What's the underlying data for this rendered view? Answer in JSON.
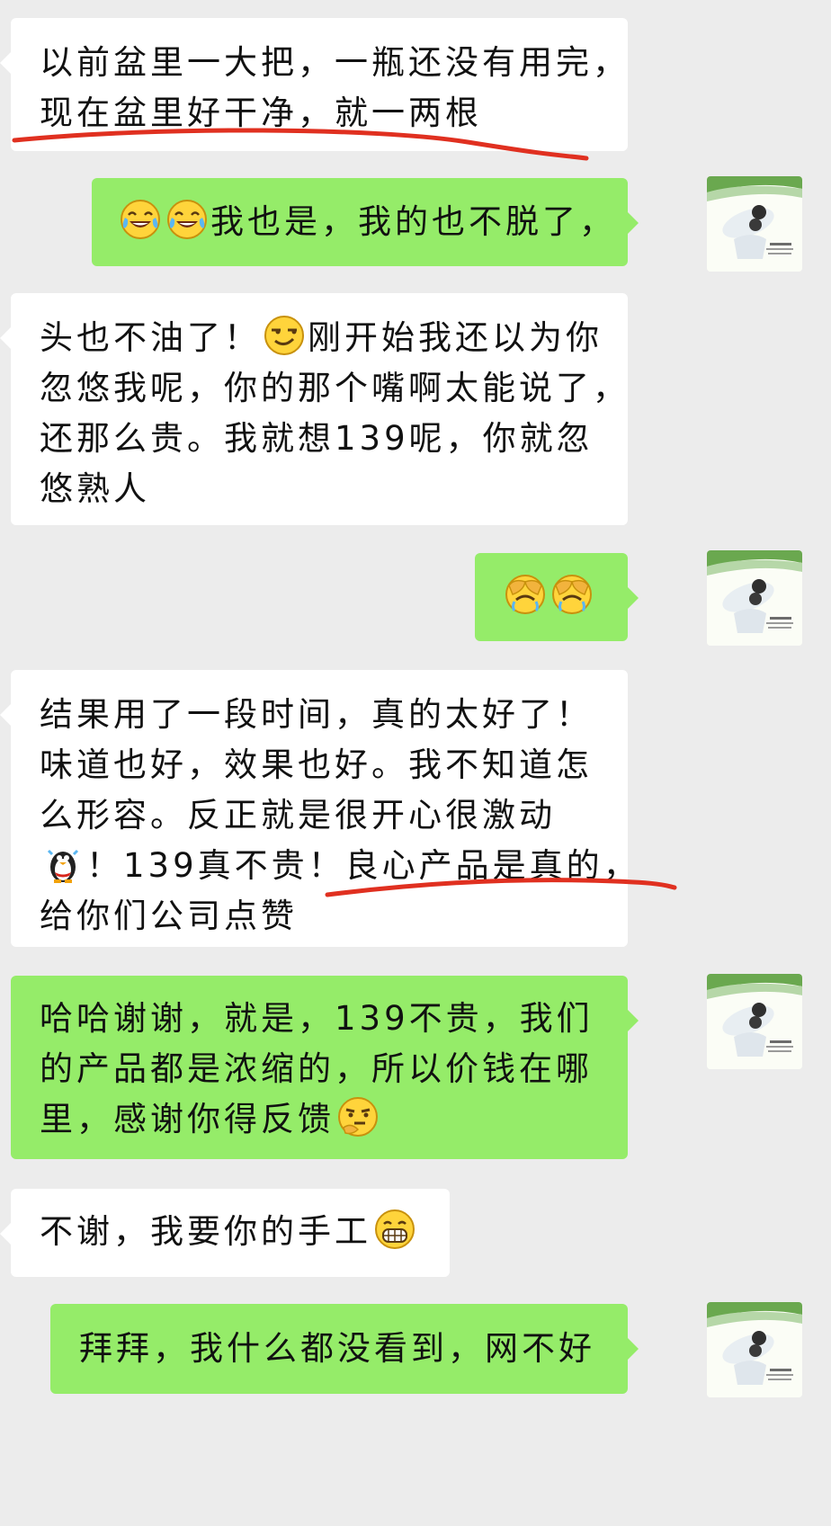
{
  "chat": {
    "messages": [
      {
        "side": "in",
        "lines": [
          "以前盆里一大把，一瓶还没有用完，",
          "现在盆里好干净，就一两根"
        ]
      },
      {
        "side": "out",
        "text": "我也是，我的也不脱了，",
        "emojis": [
          "laugh-crying",
          "laugh-crying"
        ]
      },
      {
        "side": "in",
        "lines": [
          "头也不油了！",
          "刚开始我还以为你",
          "忽悠我呢，你的那个嘴啊太能说了，",
          "还那么贵。我就想139呢，你就忽",
          "悠熟人"
        ]
      },
      {
        "side": "out",
        "emojis": [
          "facepalm",
          "facepalm"
        ]
      },
      {
        "side": "in",
        "lines": [
          "结果用了一段时间，真的太好了！",
          "味道也好，效果也好。我不知道怎",
          "么形容。反正就是很开心很激动",
          "！139真不贵！良心产品是真的，",
          "给你们公司点赞"
        ]
      },
      {
        "side": "out",
        "lines": [
          "哈哈谢谢，就是，139不贵，我们",
          "的产品都是浓缩的，所以价钱在哪",
          "里，感谢你得反馈"
        ]
      },
      {
        "side": "in",
        "text": "不谢，我要你的手工"
      },
      {
        "side": "out",
        "text": "拜拜，我什么都没看到，网不好"
      }
    ]
  },
  "colors": {
    "incoming": "#ffffff",
    "outgoing": "#95ec69",
    "background": "#ececec",
    "annotation": "#e03020"
  },
  "icons": [
    "laugh-crying-emoji",
    "smug-emoji",
    "facepalm-emoji",
    "penguin-emoji",
    "thinking-emoji",
    "grin-emoji",
    "avatar-photo"
  ]
}
